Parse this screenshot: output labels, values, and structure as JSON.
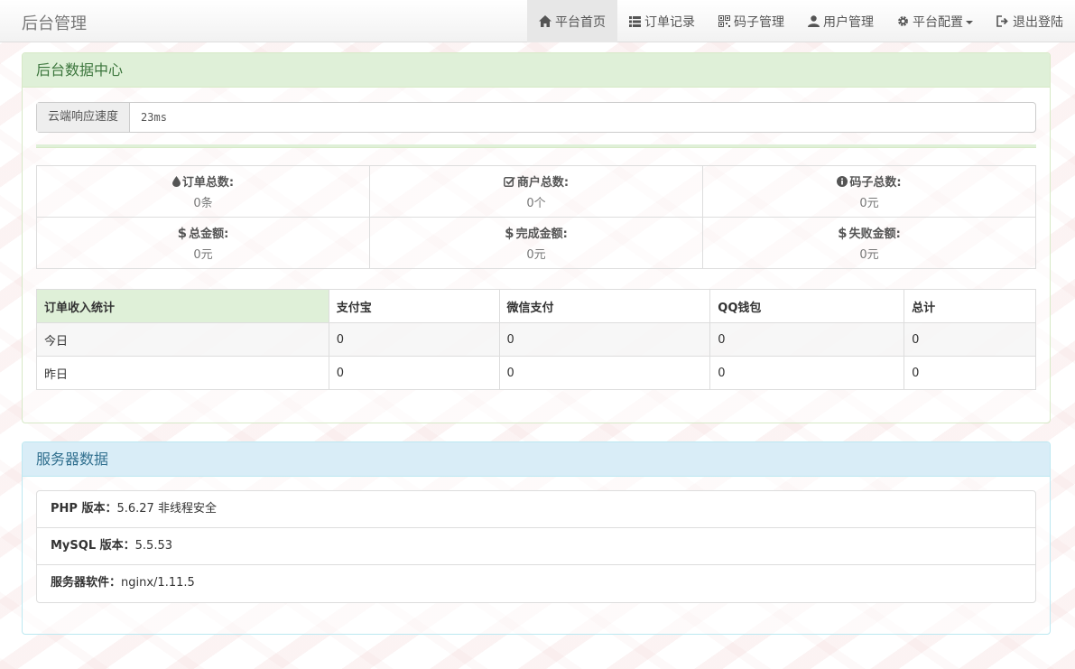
{
  "brand": "后台管理",
  "nav": {
    "items": [
      {
        "label": "平台首页",
        "icon": "home-icon",
        "active": true
      },
      {
        "label": "订单记录",
        "icon": "list-icon"
      },
      {
        "label": "码子管理",
        "icon": "qrcode-icon"
      },
      {
        "label": "用户管理",
        "icon": "user-icon"
      },
      {
        "label": "平台配置",
        "icon": "gear-icon"
      },
      {
        "label": "退出登陆",
        "icon": "logout-icon"
      }
    ]
  },
  "data_center": {
    "title": "后台数据中心",
    "speed_label": "云端响应速度",
    "speed_value": "23ms",
    "stats": [
      {
        "label": "订单总数:",
        "value": "0条",
        "icon": "tint-icon"
      },
      {
        "label": "商户总数:",
        "value": "0个",
        "icon": "check-icon"
      },
      {
        "label": "码子总数:",
        "value": "0元",
        "icon": "info-icon"
      },
      {
        "label": "总金额:",
        "value": "0元",
        "icon": "dollar-icon"
      },
      {
        "label": "完成金额:",
        "value": "0元",
        "icon": "dollar-icon"
      },
      {
        "label": "失败金额:",
        "value": "0元",
        "icon": "dollar-icon"
      }
    ],
    "income_table": {
      "headers": [
        "订单收入统计",
        "支付宝",
        "微信支付",
        "QQ钱包",
        "总计"
      ],
      "rows": [
        [
          "今日",
          "0",
          "0",
          "0",
          "0"
        ],
        [
          "昨日",
          "0",
          "0",
          "0",
          "0"
        ]
      ]
    }
  },
  "server": {
    "title": "服务器数据",
    "items": [
      {
        "label": "PHP 版本：",
        "value": "5.6.27 非线程安全"
      },
      {
        "label": "MySQL 版本：",
        "value": "5.5.53"
      },
      {
        "label": "服务器软件：",
        "value": "nginx/1.11.5"
      }
    ]
  },
  "colors": {
    "success_bg": "#dff0d8",
    "success_text": "#3c763d",
    "info_bg": "#d9edf7",
    "info_text": "#31708f"
  }
}
